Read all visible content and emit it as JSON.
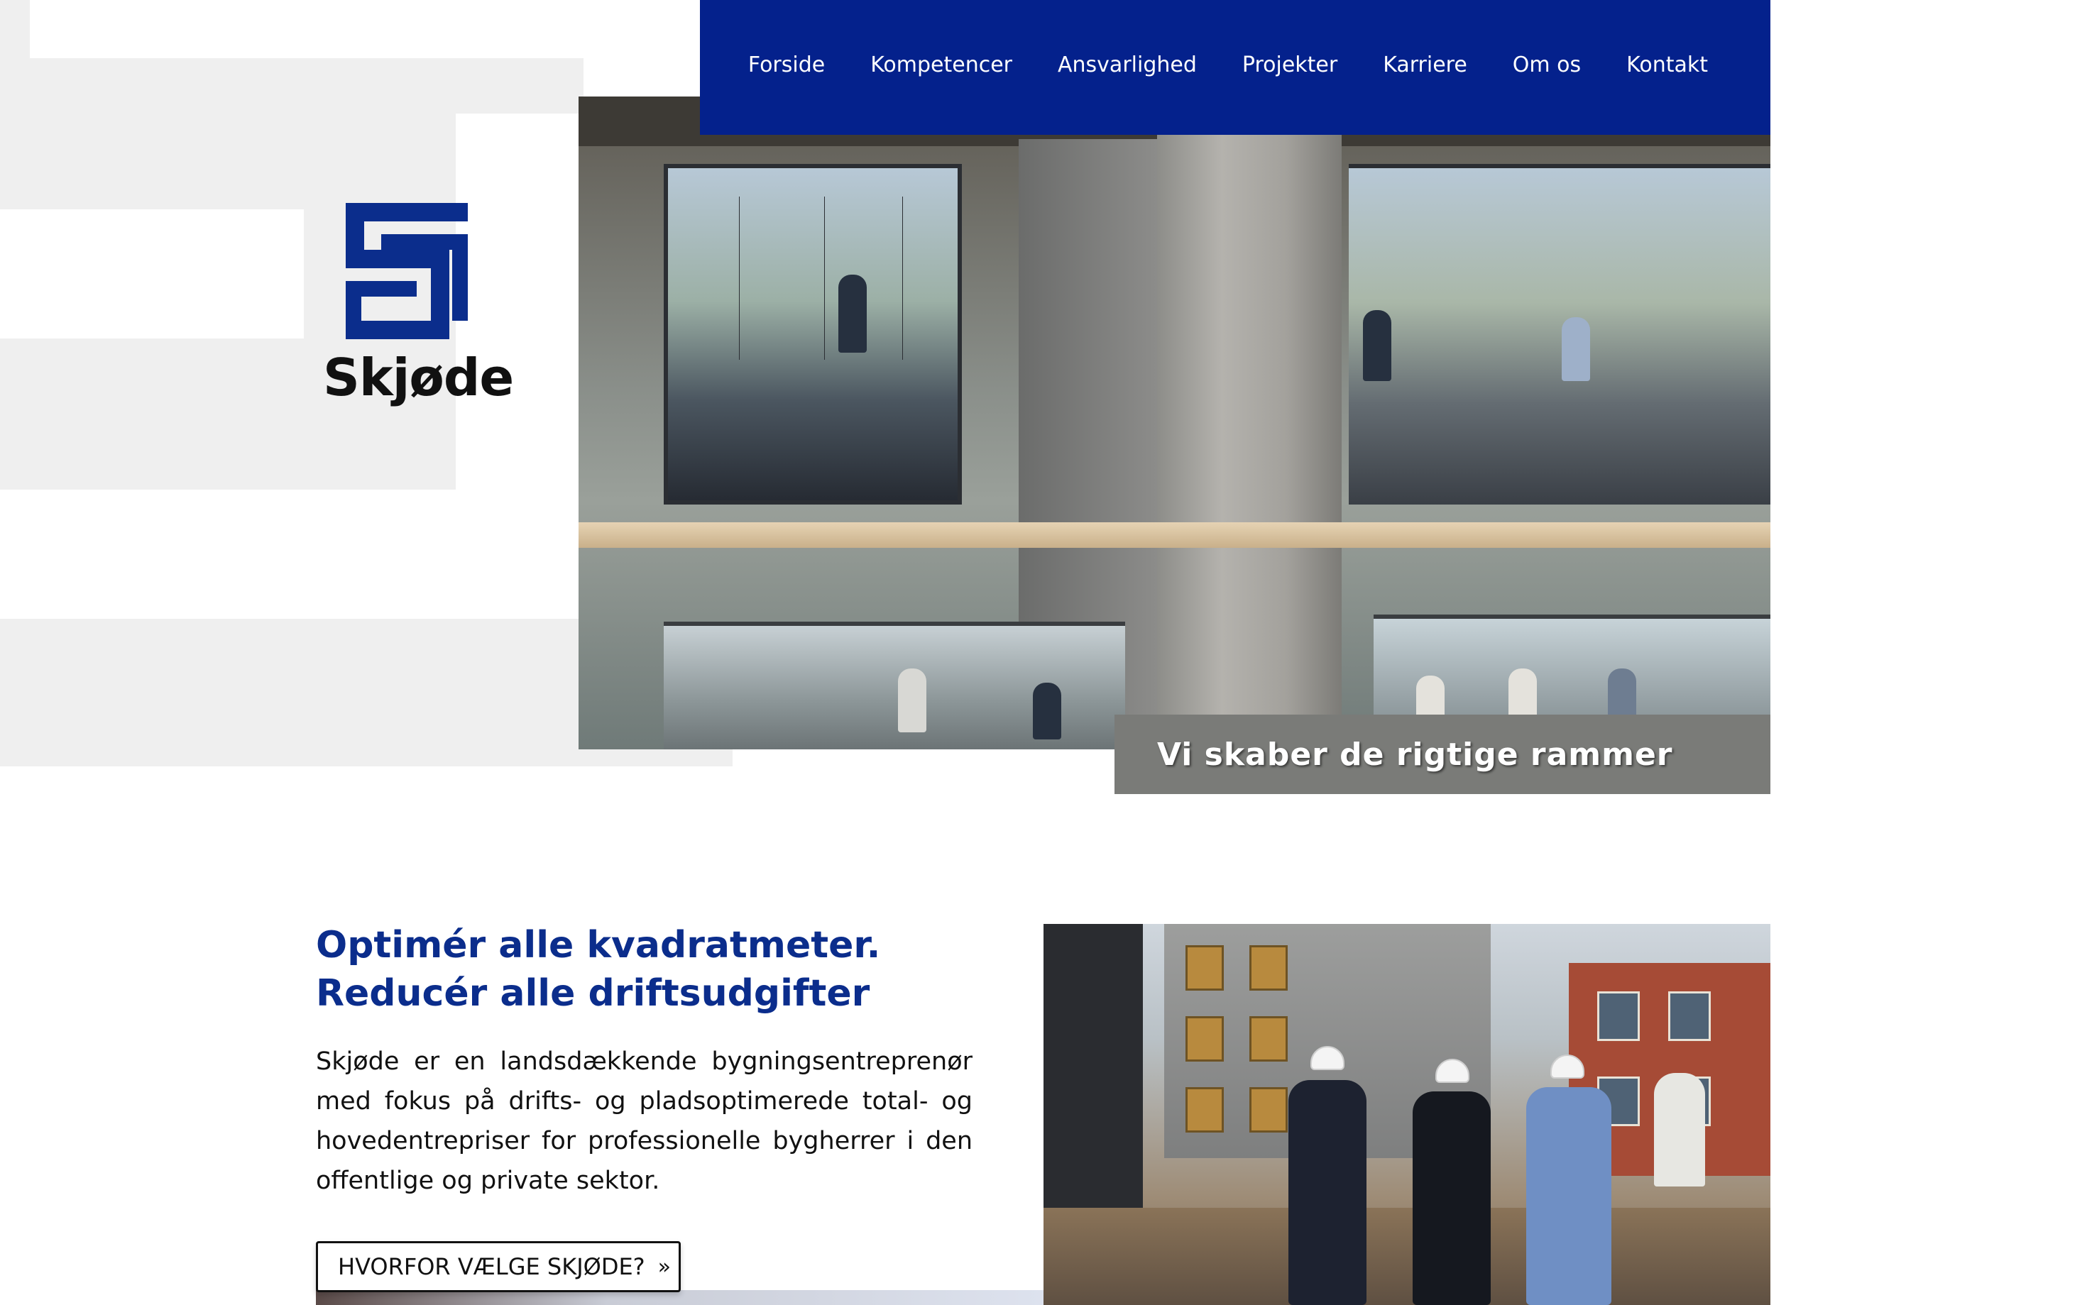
{
  "brand": {
    "name": "Skjøde",
    "primary_color": "#04218c",
    "heading_color": "#0b2d8c"
  },
  "nav": {
    "items": [
      {
        "label": "Forside"
      },
      {
        "label": "Kompetencer"
      },
      {
        "label": "Ansvarlighed"
      },
      {
        "label": "Projekter"
      },
      {
        "label": "Karriere"
      },
      {
        "label": "Om os"
      },
      {
        "label": "Kontakt"
      }
    ]
  },
  "hero": {
    "image": "office-interior-photo",
    "caption": "Vi skaber de rigtige rammer"
  },
  "intro": {
    "headline_line1": "Optimér alle kvadratmeter.",
    "headline_line2": "Reducér alle driftsudgifter",
    "body": "Skjøde er en landsdækkende bygningsentreprenør med fokus på drifts- og pladsoptimerede total- og hovedentrepriser for professionelle bygherrer i den offentlige og private sektor.",
    "cta_label": "HVORFOR VÆLGE SKJØDE?",
    "cta_icon": "double-chevron-right-icon"
  },
  "site_photo": {
    "image": "construction-site-workers-photo"
  }
}
